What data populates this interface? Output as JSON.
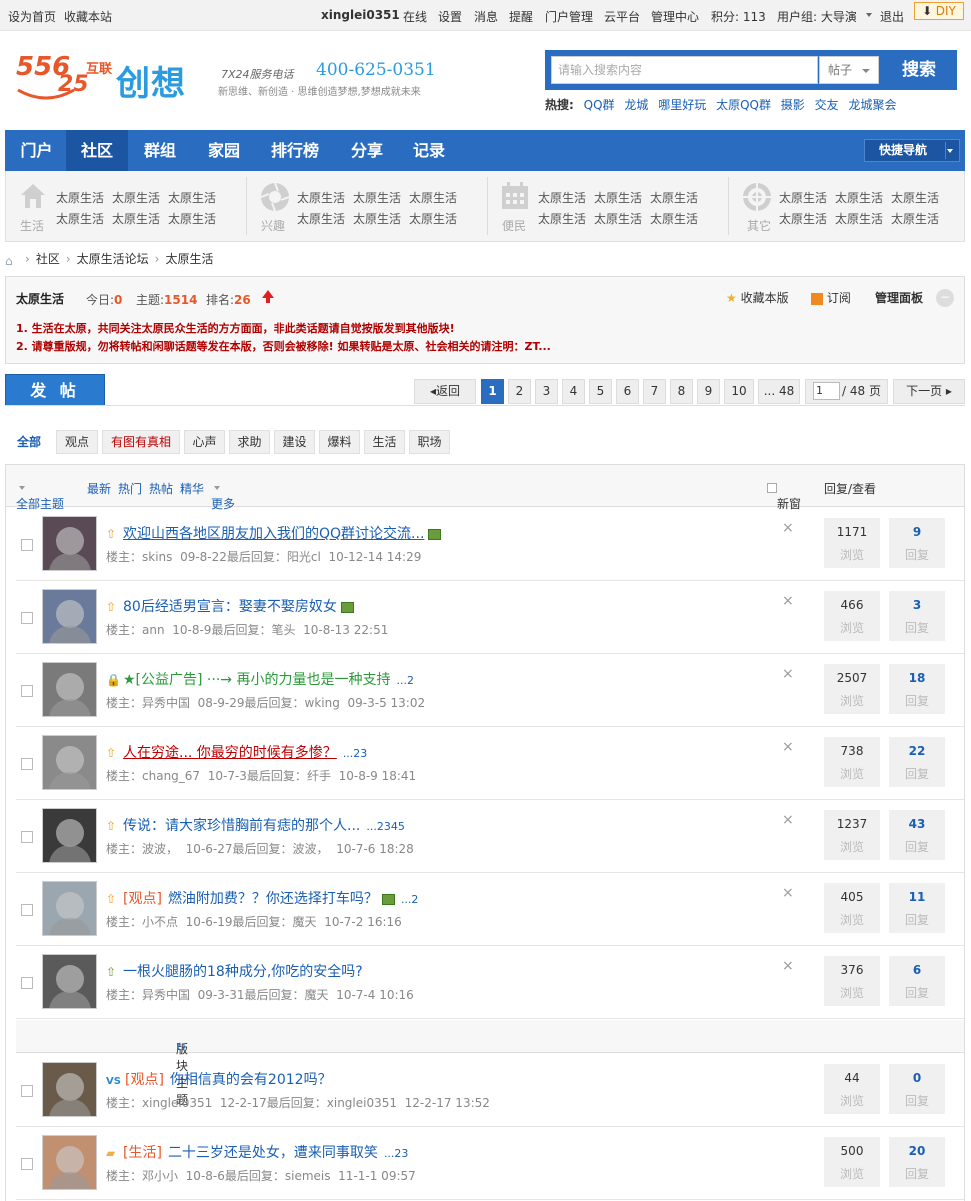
{
  "topbar": {
    "set_home": "设为首页",
    "bookmark": "收藏本站",
    "username": "xinglei0351",
    "status": "在线",
    "settings": "设置",
    "messages": "消息",
    "reminders": "提醒",
    "portal_admin": "门户管理",
    "cloud": "云平台",
    "admin_center": "管理中心",
    "points": "积分: 113",
    "usergroup": "用户组: 大导演",
    "logout": "退出",
    "diy": "DIY"
  },
  "logo": {
    "digits_top": "556",
    "digits_bottom": "25",
    "hulian": "互联",
    "chuangxiang": "创想",
    "service": "7X24服务电话",
    "phone": "400-625-0351",
    "slogan": "新思维、新创造 · 思维创造梦想,梦想成就未来"
  },
  "search": {
    "placeholder": "请输入搜索内容",
    "type": "帖子",
    "button": "搜索",
    "hot_label": "热搜:",
    "hot": [
      "QQ群",
      "龙城",
      "哪里好玩",
      "太原QQ群",
      "摄影",
      "交友",
      "龙城聚会"
    ]
  },
  "nav": {
    "items": [
      "门户",
      "社区",
      "群组",
      "家园",
      "排行榜",
      "分享",
      "记录"
    ],
    "active": "社区",
    "quick": "快捷导航"
  },
  "subnav": {
    "groups": [
      {
        "label": "生活",
        "icon": "house-icon",
        "links": [
          "太原生活",
          "太原生活",
          "太原生活",
          "太原生活",
          "太原生活",
          "太原生活"
        ]
      },
      {
        "label": "兴趣",
        "icon": "camera-aperture-icon",
        "links": [
          "太原生活",
          "太原生活",
          "太原生活",
          "太原生活",
          "太原生活",
          "太原生活"
        ]
      },
      {
        "label": "便民",
        "icon": "calendar-icon",
        "links": [
          "太原生活",
          "太原生活",
          "太原生活",
          "太原生活",
          "太原生活",
          "太原生活"
        ]
      },
      {
        "label": "其它",
        "icon": "target-icon",
        "links": [
          "太原生活",
          "太原生活",
          "太原生活",
          "太原生活",
          "太原生活",
          "太原生活"
        ]
      }
    ]
  },
  "breadcrumb": [
    "社区",
    "太原生活论坛",
    "太原生活"
  ],
  "forum": {
    "name": "太原生活",
    "today_label": "今日:",
    "today": "0",
    "topics_label": "主题:",
    "topics": "1514",
    "rank_label": "排名:",
    "rank": "26",
    "favorite": "收藏本版",
    "subscribe": "订阅",
    "panel": "管理面板",
    "rules": [
      "1. 生活在太原，共同关注太原民众生活的方方面面，非此类话题请自觉按版发到其他版块!",
      "2. 请尊重版规，勿将转帖和闲聊话题等发在本版，否则会被移除! 如果转贴是太原、社会相关的请注明：ZT..."
    ]
  },
  "post_button": "发 帖",
  "pager": {
    "back": "返回",
    "pages": [
      "1",
      "2",
      "3",
      "4",
      "5",
      "6",
      "7",
      "8",
      "9",
      "10"
    ],
    "last": "... 48",
    "current": "1",
    "total": "/ 48 页",
    "next": "下一页"
  },
  "types": [
    "全部",
    "观点",
    "有图有真相",
    "心声",
    "求助",
    "建设",
    "爆料",
    "生活",
    "职场"
  ],
  "list_header": {
    "all_topics": "全部主题",
    "filters": [
      "最新",
      "热门",
      "热帖",
      "精华"
    ],
    "more": "更多",
    "new_window": "新窗",
    "reply_view": "回复/查看"
  },
  "threads": [
    {
      "icon": "pin-icon",
      "tag": "",
      "title": "欢迎山西各地区朋友加入我们的QQ群讨论交流...",
      "image": true,
      "pages": "",
      "author": "skins",
      "date": "09-8-22",
      "last_by": "阳光cl",
      "last_time": "10-12-14 14:29",
      "views": "1171",
      "replies": "9",
      "style": "link"
    },
    {
      "icon": "pin-icon",
      "tag": "",
      "title": "80后经适男宣言：娶妻不娶房奴女",
      "image": true,
      "pages": "",
      "author": "ann",
      "date": "10-8-9",
      "last_by": "笔头",
      "last_time": "10-8-13 22:51",
      "views": "466",
      "replies": "3",
      "style": "plain"
    },
    {
      "icon": "lock-icon",
      "tag": "",
      "title": "★[公益广告] ···→ 再小的力量也是一种支持",
      "image": false,
      "pages": "...2",
      "author": "异秀中国",
      "date": "08-9-29",
      "last_by": "wking",
      "last_time": "09-3-5 13:02",
      "views": "2507",
      "replies": "18",
      "style": "green"
    },
    {
      "icon": "pin-icon",
      "tag": "",
      "title": "人在穷途... 你最穷的时候有多惨？",
      "image": false,
      "pages": "...23",
      "author": "chang_67",
      "date": "10-7-3",
      "last_by": "纤手",
      "last_time": "10-8-9 18:41",
      "views": "738",
      "replies": "22",
      "style": "red"
    },
    {
      "icon": "pin-icon",
      "tag": "",
      "title": "传说：请大家珍惜胸前有痣的那个人...",
      "image": false,
      "pages": "...2345",
      "author": "波波，",
      "date": "10-6-27",
      "last_by": "波波，",
      "last_time": "10-7-6 18:28",
      "views": "1237",
      "replies": "43",
      "style": "plain"
    },
    {
      "icon": "pin-icon",
      "tag": "[观点]",
      "title": "燃油附加费？？你还选择打车吗？",
      "image": true,
      "pages": "...2",
      "author": "小不点",
      "date": "10-6-19",
      "last_by": "魔天",
      "last_time": "10-7-2 16:16",
      "views": "405",
      "replies": "11",
      "style": "plain"
    },
    {
      "icon": "up-icon",
      "tag": "",
      "title": "一根火腿肠的18种成分,你吃的安全吗?",
      "image": false,
      "pages": "",
      "author": "异秀中国",
      "date": "09-3-31",
      "last_by": "魔天",
      "last_time": "10-7-4 10:16",
      "views": "376",
      "replies": "6",
      "style": "plain"
    }
  ],
  "section_label": "版块主题",
  "threads2": [
    {
      "icon": "vs-icon",
      "tag": "[观点]",
      "title": "你相信真的会有2012吗？",
      "pages": "",
      "author": "xinglei0351",
      "date": "12-2-17",
      "last_by": "xinglei0351",
      "last_time": "12-2-17 13:52",
      "views": "44",
      "replies": "0"
    },
    {
      "icon": "folder-icon",
      "tag": "[生活]",
      "title": "二十三岁还是处女，遭来同事取笑",
      "pages": "...23",
      "author": "邓小小",
      "date": "10-8-6",
      "last_by": "siemeis",
      "last_time": "11-1-1 09:57",
      "views": "500",
      "replies": "20"
    }
  ],
  "labels": {
    "author": "楼主：",
    "last": "最后回复：",
    "views": "浏览",
    "replies": "回复"
  },
  "colors": {
    "brand_blue": "#2a6cc0",
    "brand_orange": "#e8572a",
    "link": "#1a5fb4",
    "rule_red": "#b00000"
  }
}
